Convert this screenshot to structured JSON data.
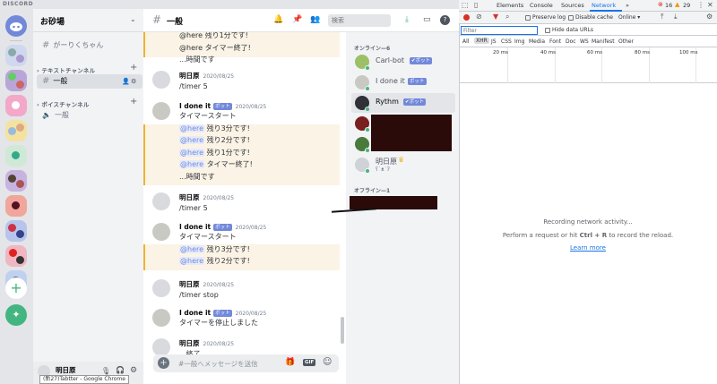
{
  "app": {
    "title": "DISCORD"
  },
  "server": {
    "name": "お砂場"
  },
  "channels": {
    "pinned": "がーりくちゃん",
    "text_category": "テキストチャンネル",
    "voice_category": "ボイスチャンネル",
    "text_channel": "一般",
    "voice_channel": "一般"
  },
  "user": {
    "name": "明日原",
    "tooltip": "(新27)Tabtter - Google Chrome"
  },
  "header": {
    "channel": "一般",
    "search_placeholder": "検索"
  },
  "chat": {
    "bot_badge": "ボット",
    "mention": "@here",
    "top_lines": [
      "@here 残り1分です!",
      "@here タイマー終了!",
      "...時間です"
    ],
    "messages": [
      {
        "author": "明日原",
        "time": "2020/08/25",
        "lines": [
          "/timer 5"
        ]
      },
      {
        "author": "I done it",
        "bot": true,
        "time": "2020/08/25",
        "lines": [
          "タイマースタート",
          "残り3分です!",
          "残り2分です!",
          "残り1分です!",
          "タイマー終了!",
          "...時間です"
        ]
      },
      {
        "author": "明日原",
        "time": "2020/08/25",
        "lines": [
          "/timer 5"
        ]
      },
      {
        "author": "I done it",
        "bot": true,
        "time": "2020/08/25",
        "lines": [
          "タイマースタート",
          "残り3分です!",
          "残り2分です!"
        ]
      },
      {
        "author": "明日原",
        "time": "2020/08/25",
        "lines": [
          "/timer stop"
        ]
      },
      {
        "author": "I done it",
        "bot": true,
        "time": "2020/08/25",
        "lines": [
          "タイマーを停止しました"
        ]
      },
      {
        "author": "明日原",
        "time": "2020/08/25",
        "lines": [
          "...終了"
        ]
      }
    ],
    "composer_placeholder": "#一般へメッセージを送信",
    "gif": "GIF"
  },
  "members": {
    "online_header": "オンライン—6",
    "offline_header": "オフライン—1",
    "list": [
      {
        "name": "Carl-bot",
        "badge": "✔ボット"
      },
      {
        "name": "I done it",
        "badge": "ボット"
      },
      {
        "name": "Rythm",
        "badge": "✔ボット"
      },
      {
        "name": "明日原",
        "status": "ʕ˙ᴥ˙ʔ"
      }
    ]
  },
  "devtools": {
    "tabs": [
      "Elements",
      "Console",
      "Sources",
      "Network"
    ],
    "active_tab": "Network",
    "more": "»",
    "errors": "16",
    "warnings": "29",
    "preserve_log": "Preserve log",
    "disable_cache": "Disable cache",
    "throttle": "Online",
    "filter_placeholder": "Filter",
    "hide_data_urls": "Hide data URLs",
    "types": [
      "All",
      "XHR",
      "JS",
      "CSS",
      "Img",
      "Media",
      "Font",
      "Doc",
      "WS",
      "Manifest",
      "Other"
    ],
    "timeline": [
      "20 ms",
      "40 ms",
      "60 ms",
      "80 ms",
      "100 ms"
    ],
    "empty_title": "Recording network activity...",
    "empty_hint_pre": "Perform a request or hit",
    "empty_hint_key": "Ctrl + R",
    "empty_hint_post": "to record the reload.",
    "learn_more": "Learn more"
  }
}
